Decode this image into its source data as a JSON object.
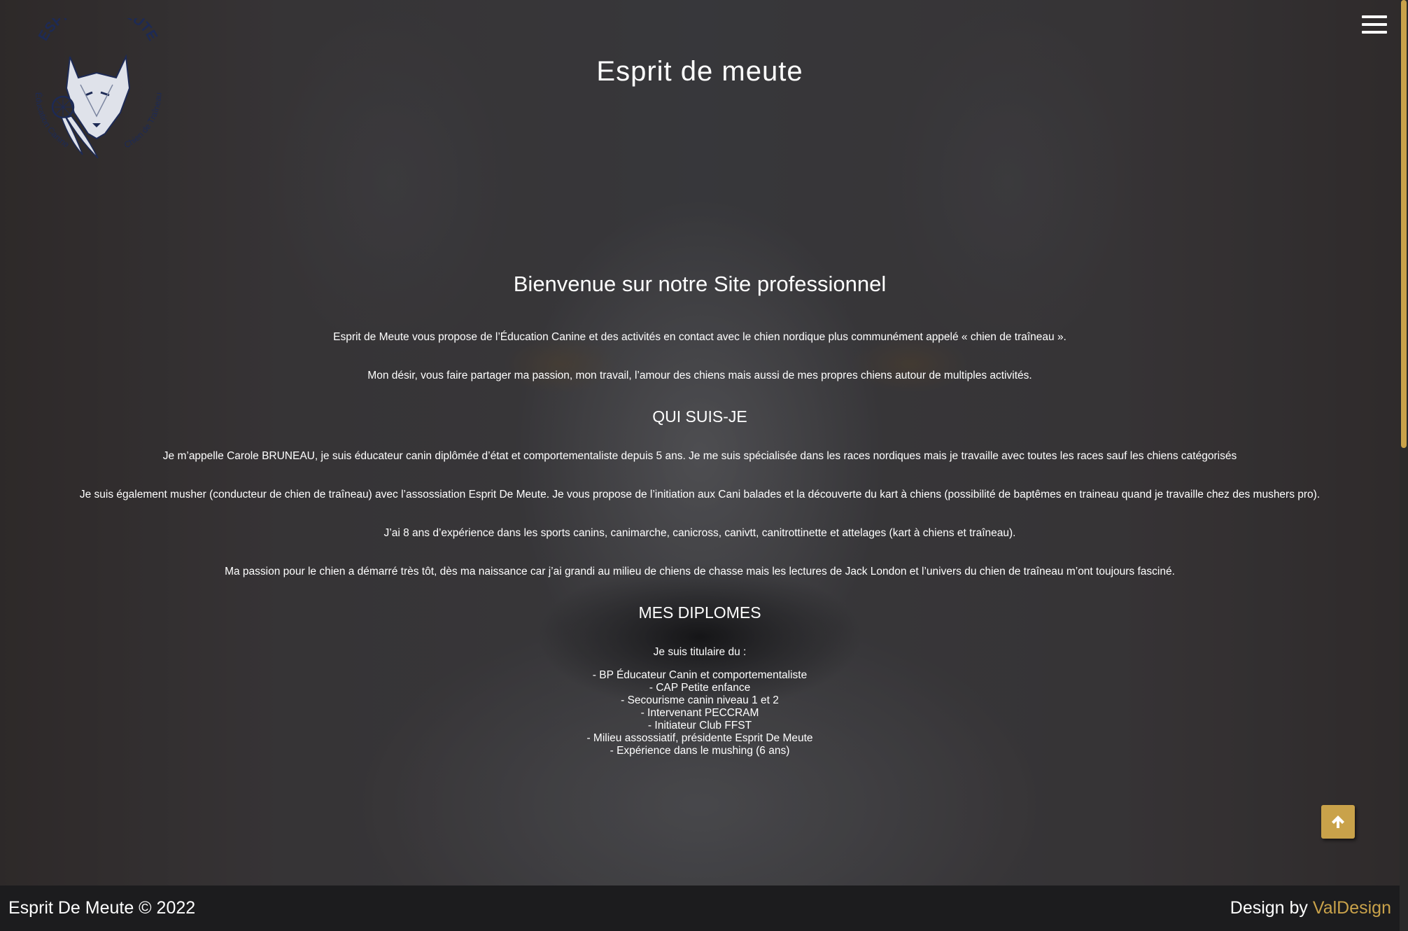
{
  "header": {
    "title": "Esprit de meute",
    "logo": {
      "top_text": "ESPRIT DE MEUTE",
      "left_text": "Éducation Canine",
      "right_text": "Chien de Traîneau",
      "icon": "wolf-head-logo"
    },
    "menu_icon": "hamburger-menu-icon"
  },
  "main": {
    "welcome": "Bienvenue sur notre Site professionnel",
    "intro": [
      "Esprit de Meute vous propose de l’Éducation Canine et des activités en contact avec le chien nordique plus communément appelé « chien de traîneau ».",
      "Mon désir, vous faire partager ma passion, mon travail, l’amour des chiens mais aussi de mes propres chiens autour de multiples activités."
    ],
    "about": {
      "title": "QUI SUIS-JE",
      "paragraphs": [
        "Je m’appelle Carole BRUNEAU, je suis éducateur canin diplômée d’état et comportementaliste depuis 5 ans. Je me suis spécialisée dans les races nordiques mais je travaille avec toutes les races sauf les chiens catégorisés",
        "Je suis également musher (conducteur de chien de traîneau) avec l’assossiation Esprit De Meute. Je vous propose de l’initiation aux Cani balades et la découverte du kart à chiens (possibilité de baptêmes en traineau quand je travaille chez des mushers pro).",
        "J’ai 8 ans d’expérience dans les sports canins, canimarche, canicross, canivtt, canitrottinette et attelages (kart à chiens et traîneau).",
        "Ma passion pour le chien a démarré très tôt, dès ma naissance car j’ai grandi au milieu de chiens de chasse mais les lectures de Jack London et l’univers du chien de traîneau m’ont toujours fasciné."
      ]
    },
    "diplomas": {
      "title": "MES DIPLOMES",
      "intro": "Je suis titulaire du :",
      "items": [
        "- BP Éducateur Canin et comportementaliste",
        "- CAP Petite enfance",
        "- Secourisme canin niveau 1 et 2",
        "- Intervenant PECCRAM",
        "- Initiateur Club FFST",
        "- Milieu assossiatif, présidente Esprit De Meute",
        "- Expérience dans le mushing (6 ans)"
      ]
    }
  },
  "scroll_top": {
    "icon": "arrow-up-icon"
  },
  "footer": {
    "copyright": "Esprit De Meute © 2022",
    "design_prefix": "Design by",
    "designer": "ValDesign"
  },
  "colors": {
    "accent": "#c9a24a",
    "footer_bg": "#1c1c1e",
    "text": "#ffffff"
  }
}
